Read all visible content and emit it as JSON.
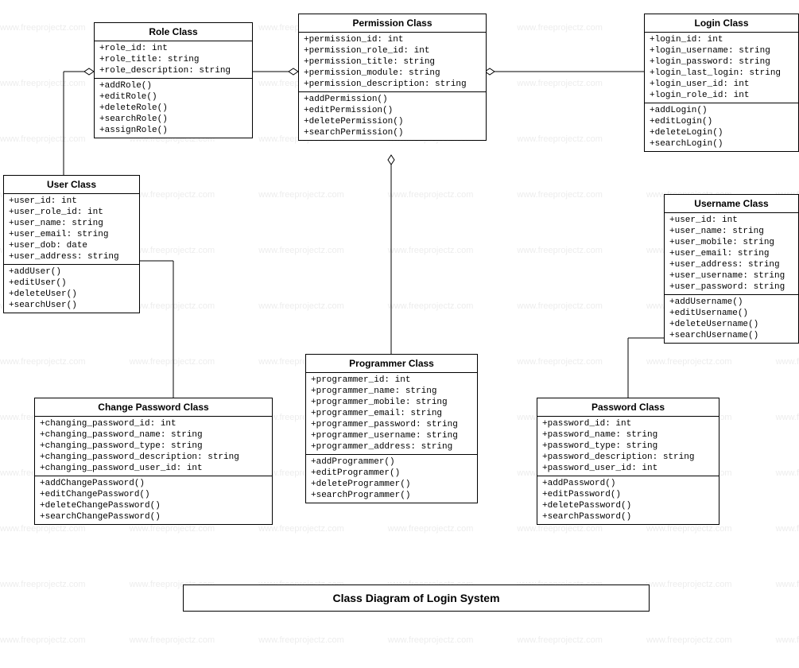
{
  "diagram_title": "Class Diagram of Login System",
  "watermark": "www.freeprojectz.com",
  "classes": {
    "role": {
      "title": "Role Class",
      "attributes": [
        "+role_id: int",
        "+role_title: string",
        "+role_description: string"
      ],
      "methods": [
        "+addRole()",
        "+editRole()",
        "+deleteRole()",
        "+searchRole()",
        "+assignRole()"
      ]
    },
    "permission": {
      "title": "Permission Class",
      "attributes": [
        "+permission_id: int",
        "+permission_role_id: int",
        "+permission_title: string",
        "+permission_module: string",
        "+permission_description: string"
      ],
      "methods": [
        "+addPermission()",
        "+editPermission()",
        "+deletePermission()",
        "+searchPermission()"
      ]
    },
    "login": {
      "title": "Login Class",
      "attributes": [
        "+login_id: int",
        "+login_username: string",
        "+login_password: string",
        "+login_last_login: string",
        "+login_user_id: int",
        "+login_role_id: int"
      ],
      "methods": [
        "+addLogin()",
        "+editLogin()",
        "+deleteLogin()",
        "+searchLogin()"
      ]
    },
    "user": {
      "title": "User Class",
      "attributes": [
        "+user_id: int",
        "+user_role_id: int",
        "+user_name: string",
        "+user_email: string",
        "+user_dob: date",
        "+user_address: string"
      ],
      "methods": [
        "+addUser()",
        "+editUser()",
        "+deleteUser()",
        "+searchUser()"
      ]
    },
    "username": {
      "title": "Username Class",
      "attributes": [
        "+user_id: int",
        "+user_name: string",
        "+user_mobile: string",
        "+user_email: string",
        "+user_address: string",
        "+user_username: string",
        "+user_password: string"
      ],
      "methods": [
        "+addUsername()",
        "+editUsername()",
        "+deleteUsername()",
        "+searchUsername()"
      ]
    },
    "programmer": {
      "title": "Programmer Class",
      "attributes": [
        "+programmer_id: int",
        "+programmer_name: string",
        "+programmer_mobile: string",
        "+programmer_email: string",
        "+programmer_password: string",
        "+programmer_username: string",
        "+programmer_address: string"
      ],
      "methods": [
        "+addProgrammer()",
        "+editProgrammer()",
        "+deleteProgrammer()",
        "+searchProgrammer()"
      ]
    },
    "changepassword": {
      "title": "Change Password Class",
      "attributes": [
        "+changing_password_id: int",
        "+changing_password_name: string",
        "+changing_password_type: string",
        "+changing_password_description: string",
        "+changing_password_user_id: int"
      ],
      "methods": [
        "+addChangePassword()",
        "+editChangePassword()",
        "+deleteChangePassword()",
        "+searchChangePassword()"
      ]
    },
    "password": {
      "title": "Password Class",
      "attributes": [
        "+password_id: int",
        "+password_name: string",
        "+password_type: string",
        "+password_description: string",
        "+password_user_id: int"
      ],
      "methods": [
        "+addPassword()",
        "+editPassword()",
        "+deletePassword()",
        "+searchPassword()"
      ]
    }
  }
}
